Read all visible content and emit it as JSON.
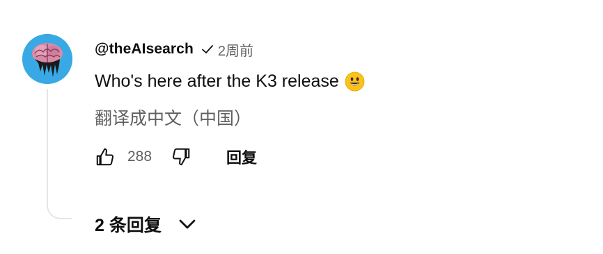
{
  "comment": {
    "author": "@theAIsearch",
    "verified_icon": "checkmark-icon",
    "timestamp": "2周前",
    "text": "Who's here after the K3 release",
    "emoji": "grinning-face-emoji",
    "translate_link": "翻译成中文（中国）",
    "likes": "288",
    "reply_label": "回复",
    "replies_toggle_label": "2 条回复"
  },
  "colors": {
    "avatar_bg": "#39a9e5",
    "text_primary": "#0f0f0f",
    "text_secondary": "#606060",
    "thread_line": "#e5e5e5"
  }
}
